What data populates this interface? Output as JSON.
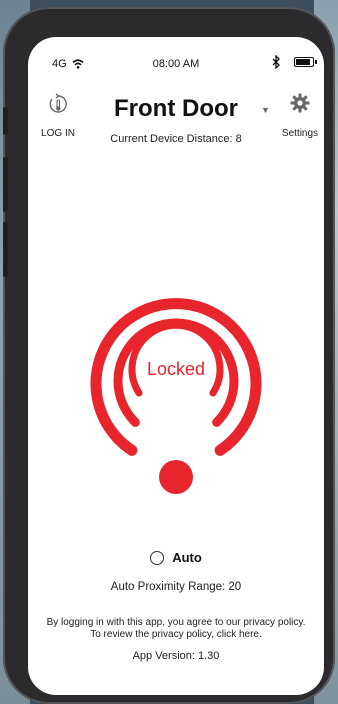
{
  "status_bar": {
    "network": "4G",
    "time": "08:00 AM"
  },
  "header": {
    "login_label": "LOG IN",
    "title": "Front Door",
    "distance_text": "Current Device Distance: 8",
    "settings_label": "Settings"
  },
  "lock": {
    "status": "Locked",
    "accent_color": "#e8242d"
  },
  "auto": {
    "label": "Auto",
    "selected": false,
    "range_text": "Auto Proximity Range: 20"
  },
  "footer": {
    "privacy_line1": "By logging in with this app, you agree to our privacy policy.",
    "privacy_line2": "To review the privacy policy, click here.",
    "version_text": "App Version: 1.30"
  },
  "icons": {
    "login": "thermometer-refresh-icon",
    "settings": "gear-icon",
    "dropdown": "caret-down-icon"
  }
}
